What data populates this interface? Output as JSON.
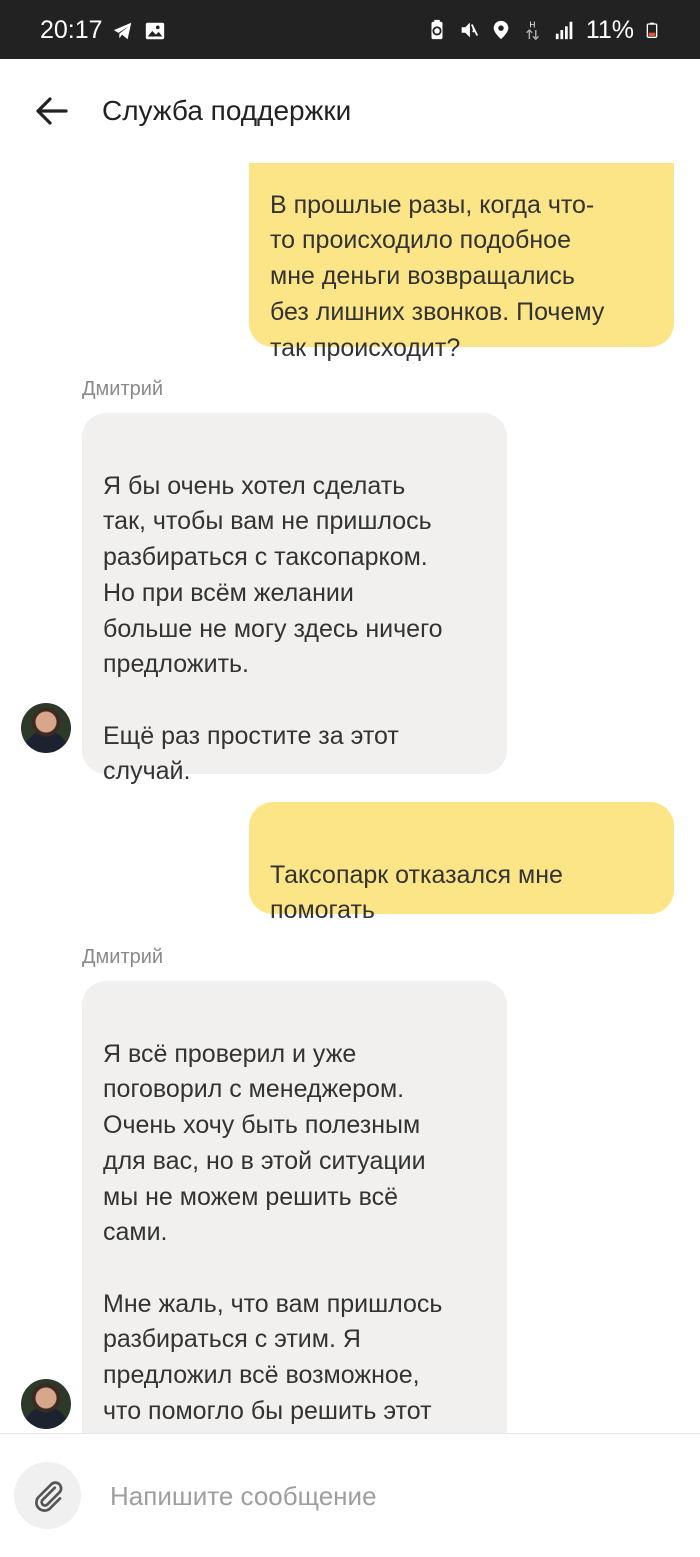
{
  "status_bar": {
    "time": "20:17",
    "battery": "11%",
    "icons": [
      "telegram-icon",
      "gallery-icon",
      "battery-saver-icon",
      "mute-icon",
      "location-icon",
      "data-transfer-icon",
      "signal-icon",
      "battery-icon"
    ],
    "network_label": "H"
  },
  "header": {
    "title": "Служба поддержки",
    "back_icon": "arrow-left-icon"
  },
  "messages": [
    {
      "direction": "outgoing",
      "text": "В прошлые разы, когда что-\nто происходило подобное\nмне деньги возвращались\nбез лишних звонков. Почему\nтак происходит?"
    },
    {
      "direction": "incoming",
      "sender": "Дмитрий",
      "text": "Я бы очень хотел сделать\nтак, чтобы вам не пришлось\nразбираться с таксопарком.\nНо при всём желании\nбольше не могу здесь ничего\nпредложить.\n\nЕщё раз простите за этот\nслучай."
    },
    {
      "direction": "outgoing",
      "text": "Таксопарк отказался мне\nпомогать"
    },
    {
      "direction": "incoming",
      "sender": "Дмитрий",
      "text": "Я всё проверил и уже\nпоговорил с менеджером.\nОчень хочу быть полезным\nдля вас, но в этой ситуации\nмы не можем решить всё\nсами.\n\nМне жаль, что вам пришлось\nразбираться с этим. Я\nпредложил всё возможное,\nчто помогло бы решить этот\nвопрос."
    }
  ],
  "composer": {
    "placeholder": "Напишите сообщение",
    "value": "",
    "attach_icon": "paperclip-icon"
  },
  "colors": {
    "outgoing_bubble": "#fce587",
    "incoming_bubble": "#f1f0ee",
    "status_bar": "#222222",
    "battery_low": "#e5533c"
  }
}
